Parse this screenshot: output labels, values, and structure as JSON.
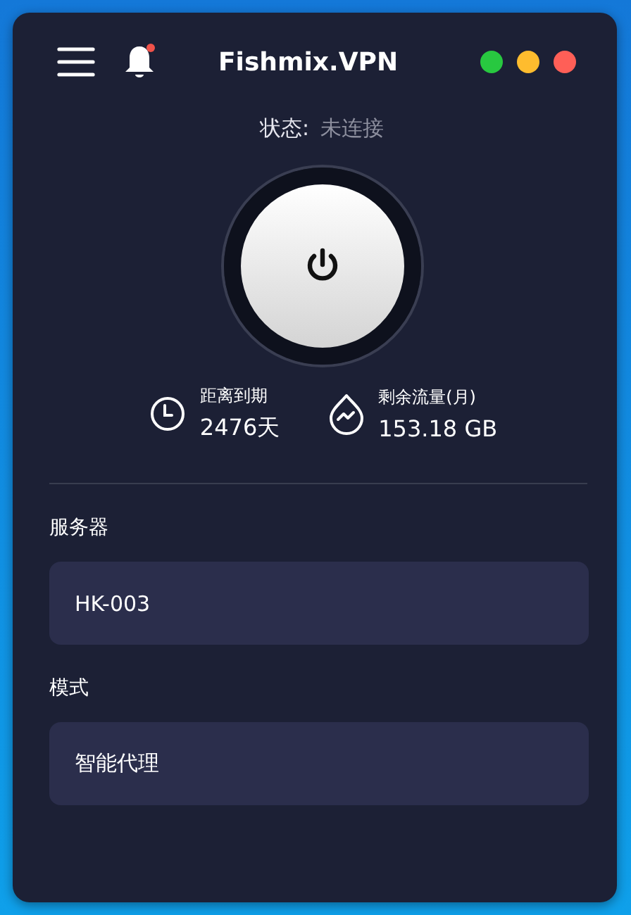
{
  "window": {
    "title": "Fishmix.VPN",
    "notification": true,
    "controls": [
      {
        "color": "#28c840"
      },
      {
        "color": "#febc2e"
      },
      {
        "color": "#ff5f57"
      }
    ]
  },
  "status": {
    "label": "状态:",
    "value": "未连接"
  },
  "stats": [
    {
      "kind": "clock",
      "label": "距离到期",
      "value": "2476天"
    },
    {
      "kind": "traffic",
      "label": "剩余流量(月)",
      "value": "153.18 GB"
    }
  ],
  "fields": [
    {
      "label": "服务器",
      "value": "HK-003"
    },
    {
      "label": "模式",
      "value": "智能代理"
    }
  ]
}
